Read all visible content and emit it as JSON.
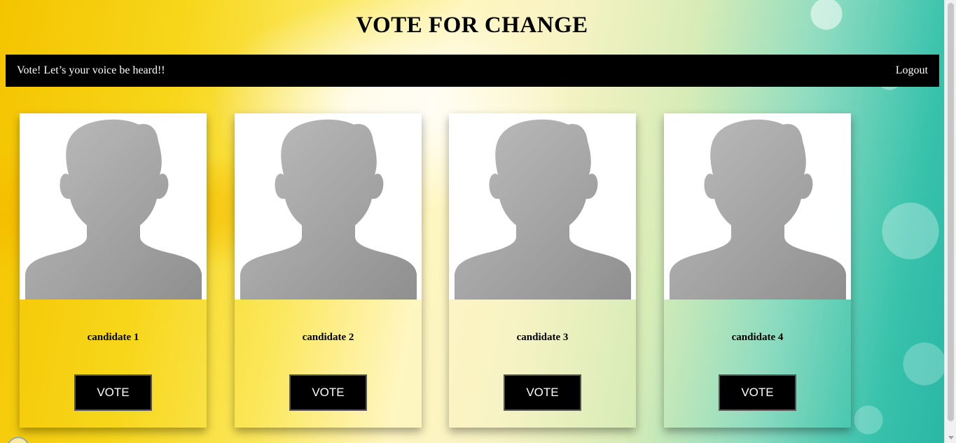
{
  "header": {
    "title": "VOTE FOR CHANGE"
  },
  "navbar": {
    "tagline": "Vote! Let’s your voice be heard!!",
    "logout_label": "Logout"
  },
  "candidates": [
    {
      "name": "candidate 1",
      "vote_label": "VOTE",
      "avatar_icon": "person-silhouette-icon"
    },
    {
      "name": "candidate 2",
      "vote_label": "VOTE",
      "avatar_icon": "person-silhouette-icon"
    },
    {
      "name": "candidate 3",
      "vote_label": "VOTE",
      "avatar_icon": "person-silhouette-icon"
    },
    {
      "name": "candidate 4",
      "vote_label": "VOTE",
      "avatar_icon": "person-silhouette-icon"
    }
  ],
  "colors": {
    "navbar_bg": "#000000",
    "button_bg": "#000000",
    "avatar_fill": "#a6a6a6"
  }
}
